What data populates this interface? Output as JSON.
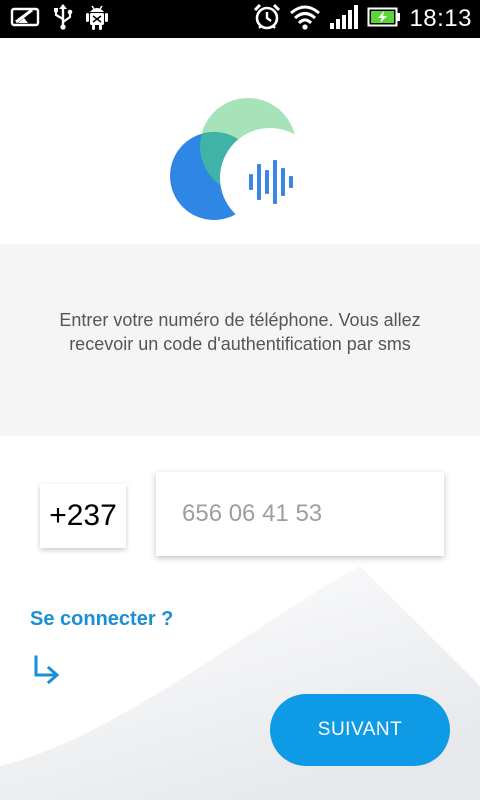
{
  "status_bar": {
    "time": "18:13",
    "left_icons": [
      "notification-icon",
      "usb-icon",
      "android-debug-icon"
    ],
    "right_icons": [
      "alarm-icon",
      "wifi-icon",
      "signal-icon",
      "battery-charging-icon"
    ]
  },
  "logo": {
    "colors": {
      "green": "#a6e3b8",
      "teal": "#3fb3a8",
      "blue": "#2f86e4",
      "bars": "#3d86e8"
    }
  },
  "instruction": {
    "text": "Entrer votre numéro de téléphone. Vous allez recevoir un code d'authentification par sms"
  },
  "form": {
    "country_code": "+237",
    "phone_placeholder": "656 06 41 53",
    "phone_value": ""
  },
  "connect_link": {
    "label": "Se connecter ?"
  },
  "next_button": {
    "label": "SUIVANT"
  },
  "colors": {
    "accent": "#0f9ae6",
    "link": "#1a8fd6",
    "panel_bg": "#f5f5f5"
  }
}
